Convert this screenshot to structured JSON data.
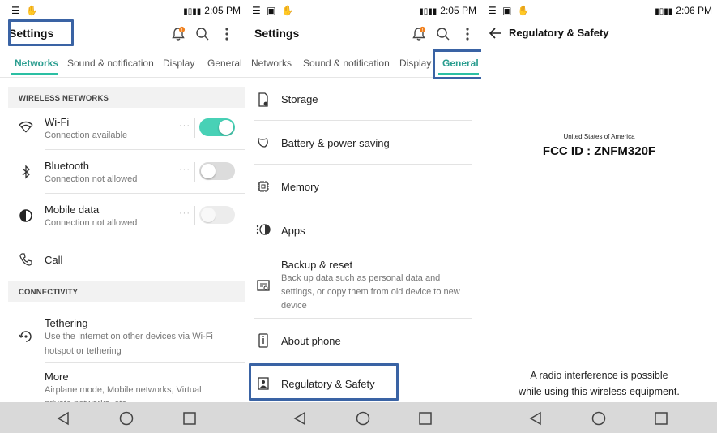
{
  "status_bars": [
    {
      "time": "2:05 PM"
    },
    {
      "time": "2:05 PM"
    },
    {
      "time": "2:06 PM"
    }
  ],
  "settings_screen": {
    "title": "Settings",
    "notification_badge": "!",
    "tabs": [
      "Networks",
      "Sound & notification",
      "Display",
      "General"
    ],
    "active_tab": "Networks",
    "wireless_header": "WIRELESS NETWORKS",
    "wireless_items": [
      {
        "label": "Wi-Fi",
        "sub": "Connection available",
        "toggle": "on",
        "icon": "wifi-icon"
      },
      {
        "label": "Bluetooth",
        "sub": "Connection not allowed",
        "toggle": "off",
        "icon": "bluetooth-icon"
      },
      {
        "label": "Mobile data",
        "sub": "Connection not allowed",
        "toggle": "disabled",
        "icon": "mobile-data-icon"
      },
      {
        "label": "Call",
        "icon": "phone-icon"
      }
    ],
    "connectivity_header": "CONNECTIVITY",
    "connectivity_items": [
      {
        "label": "Tethering",
        "sub_line1": "Use the Internet on other devices via Wi-Fi",
        "sub_line2": "hotspot or tethering",
        "icon": "tethering-icon"
      },
      {
        "label": "More",
        "sub_line1": "Airplane mode, Mobile networks, Virtual",
        "sub_line2": "private networks, etc.",
        "icon": "none"
      }
    ]
  },
  "general_screen": {
    "title": "Settings",
    "notification_badge": "!",
    "tabs": [
      "Networks",
      "Sound & notification",
      "Display",
      "General"
    ],
    "active_tab": "General",
    "items": [
      {
        "label": "Storage",
        "icon": "storage-icon"
      },
      {
        "label": "Battery & power saving",
        "icon": "battery-leaf-icon"
      },
      {
        "label": "Memory",
        "icon": "memory-chip-icon"
      },
      {
        "label": "Apps",
        "icon": "apps-icon"
      },
      {
        "label": "Backup & reset",
        "sub_line1": "Back up data such as personal data and",
        "sub_line2": "settings, or copy them from old device to new",
        "sub_line3": "device",
        "icon": "backup-icon"
      },
      {
        "label": "About phone",
        "icon": "info-icon"
      },
      {
        "label": "Regulatory & Safety",
        "icon": "regulatory-icon"
      }
    ]
  },
  "regulatory_screen": {
    "title": "Regulatory & Safety",
    "country": "United States of America",
    "fcc_id": "FCC ID : ZNFM320F",
    "note_line1": "A radio interference is possible",
    "note_line2": "while using this wireless equipment."
  },
  "colors": {
    "accent": "#2bbfa3",
    "highlight_box": "#3a63a4",
    "navbar": "#d9d9d9",
    "badge": "#f0801e"
  }
}
